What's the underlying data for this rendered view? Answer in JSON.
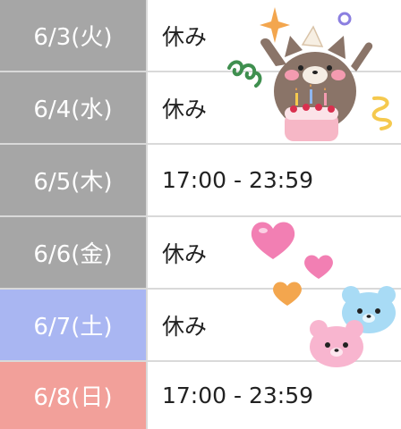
{
  "colors": {
    "weekday_bg": "#a6a6a6",
    "saturday_bg": "#a9b6f2",
    "sunday_bg": "#f2a09a",
    "divider": "#d9d9d9"
  },
  "schedule": [
    {
      "date": "6/3(火)",
      "hours": "休み",
      "day_type": "weekday"
    },
    {
      "date": "6/4(水)",
      "hours": "休み",
      "day_type": "weekday"
    },
    {
      "date": "6/5(木)",
      "hours": "17:00 - 23:59",
      "day_type": "weekday"
    },
    {
      "date": "6/6(金)",
      "hours": "休み",
      "day_type": "weekday"
    },
    {
      "date": "6/7(土)",
      "hours": "休み",
      "day_type": "saturday"
    },
    {
      "date": "6/8(日)",
      "hours": "17:00 - 23:59",
      "day_type": "sunday"
    }
  ],
  "stickers": [
    "cat-with-birthday-cake-icon",
    "sparkle-star-icon",
    "green-spiral-icon",
    "yellow-squiggle-icon",
    "purple-dot-icon",
    "pink-heart-icon",
    "orange-heart-icon",
    "blue-bear-icon",
    "pink-bear-icon"
  ]
}
